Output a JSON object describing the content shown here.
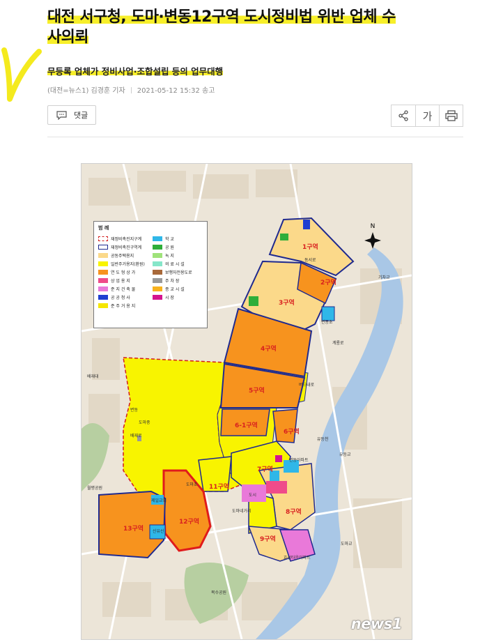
{
  "article": {
    "title_line1": "대전 서구청, 도마·변동12구역 도시정비법 위반 업체 수",
    "title_line2": "사의뢰",
    "subtitle": "무등록 업체가 정비사업·조합설립 등의 업무대행",
    "byline": "(대전=뉴스1) 김경훈 기자",
    "timestamp": "2021-05-12 15:32 송고",
    "comment_label": "댓글"
  },
  "toolbar": {
    "share_icon": "share-icon",
    "font_label": "가",
    "print_icon": "print-icon"
  },
  "colors": {
    "highlight": "#f7ef2a",
    "zone_orange": "#f7931e",
    "zone_yellow": "#f8f400",
    "zone_border": "#1f2a8f",
    "zone12_border": "#e01b1b"
  },
  "map": {
    "legend": {
      "title": "범 례",
      "left": [
        {
          "label": "재정비촉진지구계",
          "color": "#ffffff"
        },
        {
          "label": "재정비촉진구역계",
          "color": "#ffffff"
        },
        {
          "label": "공동주택용지",
          "color": "#fbd98a"
        },
        {
          "label": "일반주거용지(환원)",
          "color": "#f8f400"
        },
        {
          "label": "연 도 형 상 가",
          "color": "#f7931e"
        },
        {
          "label": "상 업 용 지",
          "color": "#ef4b8a"
        },
        {
          "label": "준 지 건 축 물",
          "color": "#e979d9"
        },
        {
          "label": "공 공 청 사",
          "color": "#1f3fd1"
        },
        {
          "label": "준 주 거 용 지",
          "color": "#f5e600"
        }
      ],
      "right": [
        {
          "label": "학 교",
          "color": "#2fb7e8"
        },
        {
          "label": "공 원",
          "color": "#2fae3a"
        },
        {
          "label": "녹 지",
          "color": "#9fe27a"
        },
        {
          "label": "의 료 시 설",
          "color": "#86e6c9"
        },
        {
          "label": "보행자전용도로",
          "color": "#a8693a"
        },
        {
          "label": "주 차 장",
          "color": "#9a9a9a"
        },
        {
          "label": "종 교 시 설",
          "color": "#f7b21e"
        },
        {
          "label": "시 장",
          "color": "#d4148f"
        }
      ]
    },
    "zones": [
      "1구역",
      "2구역",
      "3구역",
      "4구역",
      "5구역",
      "6-1구역",
      "6구역",
      "7구역",
      "8구역",
      "9구역",
      "11구역",
      "12구역",
      "13구역"
    ],
    "places": {
      "dongseoro": "동서로",
      "byeondongcho": "변동초",
      "gyeryongro": "계룡로",
      "beodeunaero": "버드내로",
      "yudeungcheon": "유등천",
      "yudeunggyo": "유등교",
      "gichagyo": "기차교",
      "baejaedae": "배재대",
      "bojaero": "배재로",
      "domijung": "도마중",
      "domicho": "도마초",
      "jaeil_church": "제일교회",
      "sinsu": "신유신",
      "domigyo": "도마교",
      "domi_nego": "도마네거리",
      "woolbang": "월평공원",
      "bokeubgongwon": "복수공원",
      "hyoseong_apt": "효성타운아파트",
      "byeondong_apt": "변동아파트",
      "dongsan": "변동",
      "dosireo": "도시"
    },
    "watermark": "news1"
  }
}
